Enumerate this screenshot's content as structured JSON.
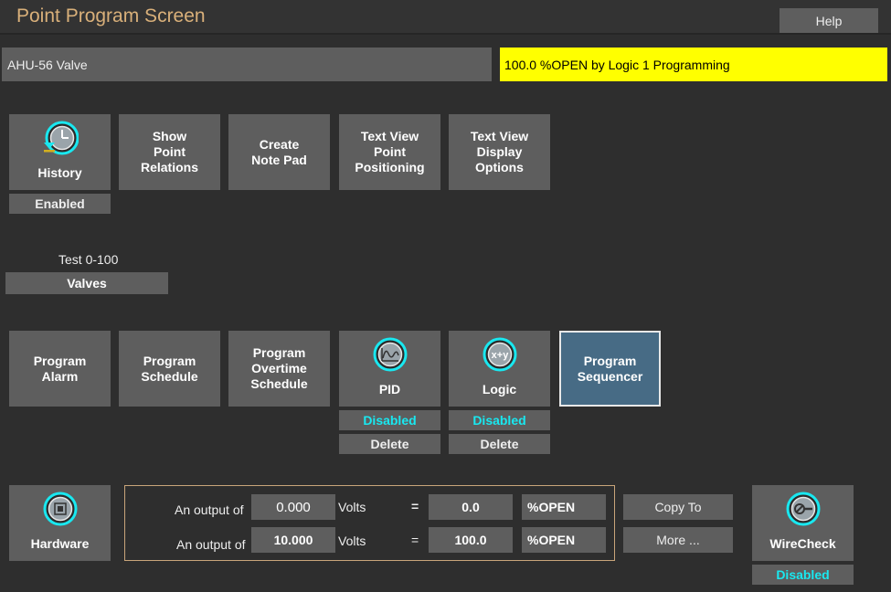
{
  "header": {
    "title": "Point Program Screen",
    "help_label": "Help"
  },
  "point": {
    "name": "AHU-56 Valve",
    "status_text": "100.0 %OPEN by Logic 1 Programming",
    "status_color": "#ffff00"
  },
  "top_tiles": {
    "history": {
      "label": "History",
      "status": "Enabled",
      "icon": "history-clock-icon"
    },
    "show_relations": "Show\nPoint\nRelations",
    "create_note_pad": "Create\nNote Pad",
    "text_view_positioning": "Text View\nPoint\nPositioning",
    "text_view_display": "Text View\nDisplay\nOptions"
  },
  "range": {
    "label": "Test 0-100",
    "type": "Valves"
  },
  "program_tiles": {
    "alarm": "Program\nAlarm",
    "schedule": "Program\nSchedule",
    "overtime": "Program\nOvertime\nSchedule",
    "pid": {
      "label": "PID",
      "status": "Disabled",
      "delete": "Delete",
      "icon": "pid-graph-icon"
    },
    "logic": {
      "label": "Logic",
      "status": "Disabled",
      "delete": "Delete",
      "icon": "logic-xy-icon",
      "icon_text": "x+y"
    },
    "sequencer": "Program\nSequencer"
  },
  "hardware": {
    "label": "Hardware",
    "icon": "hardware-chip-icon"
  },
  "scaling": {
    "rows": [
      {
        "prefix": "An output of",
        "input_value": "0.000",
        "input_unit": "Volts",
        "equals": "=",
        "output_value": "0.0",
        "output_unit": "%OPEN"
      },
      {
        "prefix": "An output of",
        "input_value": "10.000",
        "input_unit": "Volts",
        "equals": "=",
        "output_value": "100.0",
        "output_unit": "%OPEN"
      }
    ],
    "copy_to": "Copy To",
    "more": "More ..."
  },
  "wirecheck": {
    "label": "WireCheck",
    "status": "Disabled",
    "icon": "wirecheck-icon"
  },
  "colors": {
    "accent_cyan": "#19e8f0",
    "sequencer_bg": "#476b85",
    "tile_bg": "#5e5e5e"
  }
}
